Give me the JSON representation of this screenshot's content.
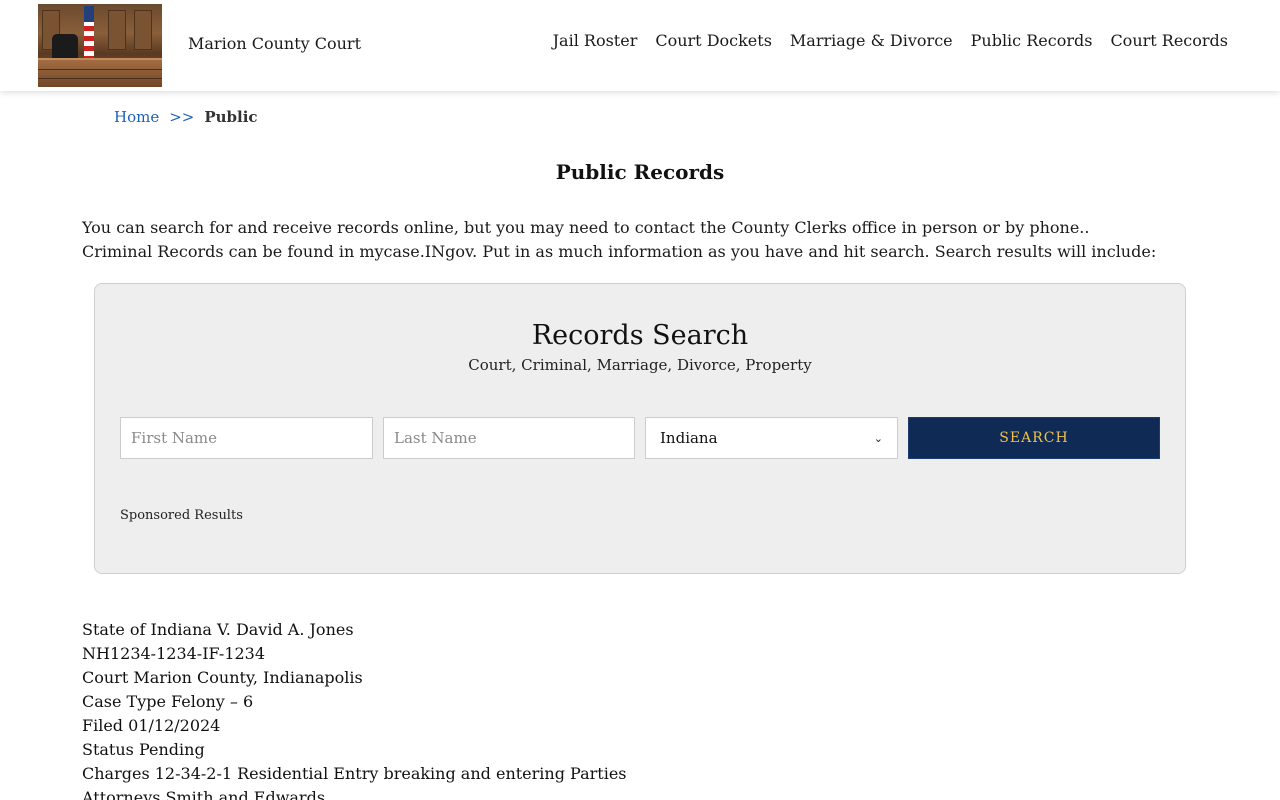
{
  "header": {
    "site_title": "Marion County Court",
    "nav": [
      "Jail Roster",
      "Court Dockets",
      "Marriage & Divorce",
      "Public Records",
      "Court Records"
    ]
  },
  "breadcrumb": {
    "home": "Home",
    "separator": ">>",
    "current": "Public"
  },
  "page_title": "Public Records",
  "intro": [
    "You can search for and receive records online, but you may need to contact the County Clerks office in person or by phone..",
    "Criminal Records can be found in mycase.INgov. Put in as much information as you have and hit search. Search results will include:"
  ],
  "search": {
    "title": "Records Search",
    "subtitle": "Court, Criminal, Marriage, Divorce, Property",
    "first_name_placeholder": "First Name",
    "last_name_placeholder": "Last Name",
    "state_selected": "Indiana",
    "button_label": "SEARCH",
    "sponsored": "Sponsored Results"
  },
  "case_example": [
    "State of Indiana V. David A. Jones",
    "NH1234-1234-IF-1234",
    "Court Marion County, Indianapolis",
    "Case Type Felony – 6",
    "Filed 01/12/2024",
    "Status Pending",
    "Charges 12-34-2-1 Residential Entry breaking and entering Parties",
    "Attorneys Smith and Edwards"
  ],
  "colors": {
    "button_bg": "#0f2a55",
    "button_text": "#f0c14b",
    "link": "#1f5fb8",
    "panel_bg": "#eeeeee"
  }
}
